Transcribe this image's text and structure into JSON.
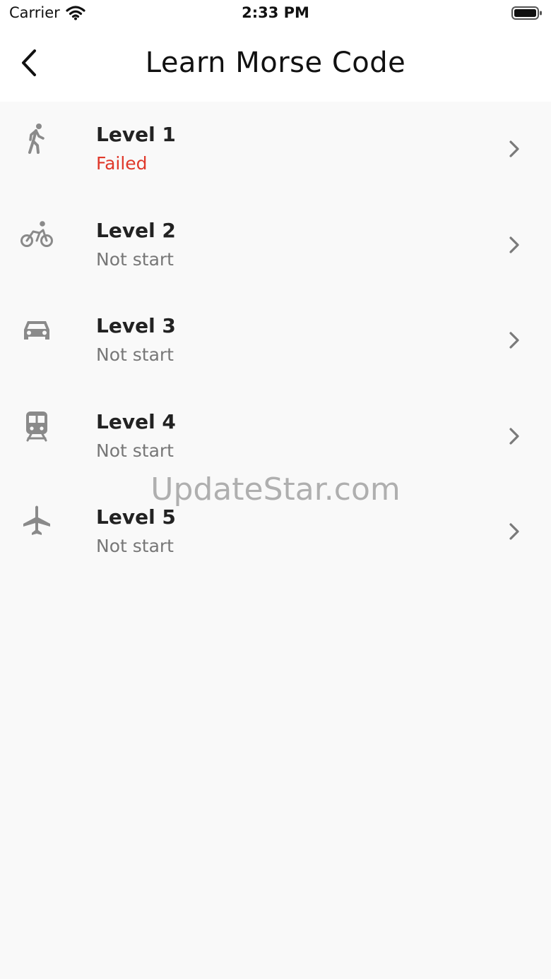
{
  "status_bar": {
    "carrier": "Carrier",
    "time": "2:33 PM",
    "icons": [
      "wifi-icon",
      "battery-icon"
    ]
  },
  "nav": {
    "title": "Learn Morse Code",
    "back_icon": "chevron-left-icon"
  },
  "levels": [
    {
      "title": "Level 1",
      "status": "Failed",
      "icon": "walking-icon"
    },
    {
      "title": "Level 2",
      "status": "Not start",
      "icon": "bicycle-icon"
    },
    {
      "title": "Level 3",
      "status": "Not start",
      "icon": "car-icon"
    },
    {
      "title": "Level 4",
      "status": "Not start",
      "icon": "train-icon"
    },
    {
      "title": "Level 5",
      "status": "Not start",
      "icon": "airplane-icon"
    }
  ],
  "watermark": "UpdateStar.com",
  "colors": {
    "failed": "#e0392b",
    "muted": "#777777",
    "icon": "#8a8a8a",
    "background": "#f9f9f9"
  }
}
